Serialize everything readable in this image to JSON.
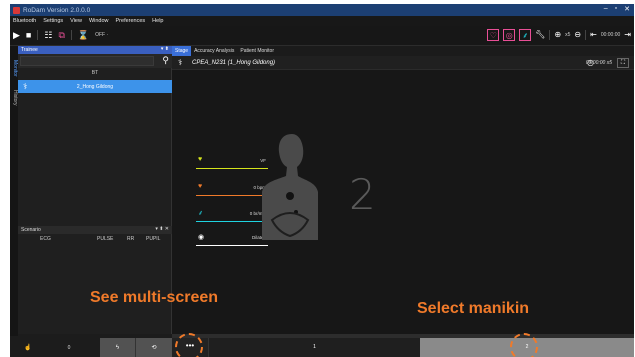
{
  "titlebar": {
    "title": "RoDam Version 2.0.0.0",
    "min": "–",
    "max": "▫",
    "close": "✕"
  },
  "menu": [
    "Bluetooth",
    "Settings",
    "View",
    "Window",
    "Preferences",
    "Help"
  ],
  "toolbar": {
    "off_label": "OFF ·",
    "speed_label": "x5",
    "time": "00:00:00"
  },
  "side_tabs": [
    "Monitor",
    "History"
  ],
  "trainee_panel": {
    "title": "Trainee",
    "controls": "▾ ⬍",
    "search_placeholder": "",
    "group": "BT",
    "trainee_name": "2_Hong Gildong"
  },
  "scenario_panel": {
    "title": "Scenario",
    "controls": "▾ ⬍ ✕",
    "columns": [
      "ECG",
      "PULSE",
      "RR",
      "PUPIL"
    ]
  },
  "main_tabs": [
    "Stage",
    "Accuracy Analysis",
    "Patient Monitor"
  ],
  "info": {
    "title": "CPEA_N231 (1_Hong Gildong)",
    "time": "00:00:00 x5"
  },
  "vitals": [
    {
      "icon": "ecg-heart-icon",
      "value": "VF",
      "color": "#d6e51c"
    },
    {
      "icon": "pulse-heart-icon",
      "value": "0 bpm",
      "color": "#f07a2a"
    },
    {
      "icon": "lungs-icon",
      "value": "0 br/min",
      "color": "#1fd3e0"
    },
    {
      "icon": "eye-icon",
      "value": "Dilated",
      "color": "#ffffff"
    }
  ],
  "manikin_number": "2",
  "bottom": {
    "count": "0",
    "slot1": "1",
    "slot2": "2",
    "more": "•••"
  },
  "callouts": {
    "left": "See multi-screen",
    "right": "Select manikin"
  },
  "colors": {
    "accent": "#3d93ea",
    "callout": "#f07a2a",
    "pink": "#e84f96",
    "cyan": "#1fd3e0"
  }
}
